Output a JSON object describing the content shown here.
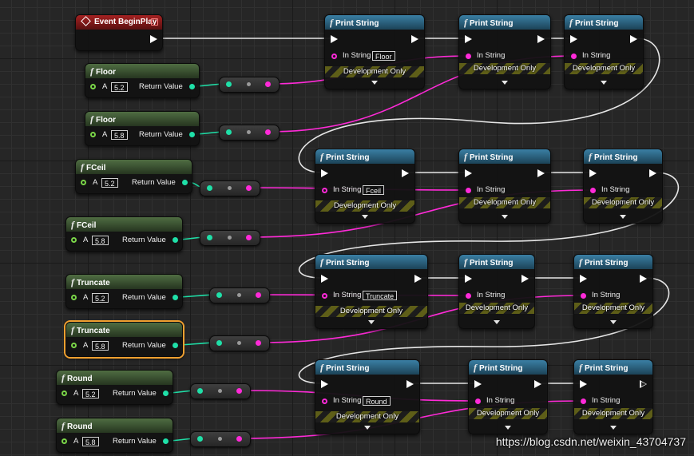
{
  "event_node": {
    "title": "Event BeginPlay"
  },
  "pure_nodes": [
    {
      "title": "Floor",
      "pin_label": "A",
      "input_value": "5.2",
      "output_label": "Return Value"
    },
    {
      "title": "Floor",
      "pin_label": "A",
      "input_value": "5.8",
      "output_label": "Return Value"
    },
    {
      "title": "FCeil",
      "pin_label": "A",
      "input_value": "5.2",
      "output_label": "Return Value"
    },
    {
      "title": "FCeil",
      "pin_label": "A",
      "input_value": "5.8",
      "output_label": "Return Value"
    },
    {
      "title": "Truncate",
      "pin_label": "A",
      "input_value": "5.2",
      "output_label": "Return Value"
    },
    {
      "title": "Truncate",
      "pin_label": "A",
      "input_value": "5.8",
      "output_label": "Return Value",
      "selected": true
    },
    {
      "title": "Round",
      "pin_label": "A",
      "input_value": "5.2",
      "output_label": "Return Value"
    },
    {
      "title": "Round",
      "pin_label": "A",
      "input_value": "5.8",
      "output_label": "Return Value"
    }
  ],
  "print_nodes": [
    {
      "title": "Print String",
      "in_label": "In String",
      "in_value": "Floor",
      "dev_label": "Development Only"
    },
    {
      "title": "Print String",
      "in_label": "In String",
      "dev_label": "Development Only"
    },
    {
      "title": "Print String",
      "in_label": "In String",
      "dev_label": "Development Only"
    },
    {
      "title": "Print String",
      "in_label": "In String",
      "in_value": "Fceil",
      "dev_label": "Development Only"
    },
    {
      "title": "Print String",
      "in_label": "In String",
      "dev_label": "Development Only"
    },
    {
      "title": "Print String",
      "in_label": "In String",
      "dev_label": "Development Only"
    },
    {
      "title": "Print String",
      "in_label": "In String",
      "in_value": "Truncate",
      "dev_label": "Development Only"
    },
    {
      "title": "Print String",
      "in_label": "In String",
      "dev_label": "Development Only"
    },
    {
      "title": "Print String",
      "in_label": "In String",
      "dev_label": "Development Only"
    },
    {
      "title": "Print String",
      "in_label": "In String",
      "in_value": "Round",
      "dev_label": "Development Only"
    },
    {
      "title": "Print String",
      "in_label": "In String",
      "dev_label": "Development Only"
    },
    {
      "title": "Print String",
      "in_label": "In String",
      "dev_label": "Development Only"
    }
  ],
  "icons": {
    "function": "function-f-icon",
    "event": "event-diamond-icon",
    "exec": "exec-arrow-icon",
    "expand": "expand-caret-icon"
  },
  "colors": {
    "exec_wire": "#e6e6e6",
    "float_pin": "#1fe0a8",
    "string_pin": "#ff2ad8",
    "selection": "#f0a030",
    "event_header": "#a52222",
    "function_header": "#3a7fa4",
    "pure_header": "#4f6d42"
  },
  "watermark": "https://blog.csdn.net/weixin_43704737"
}
